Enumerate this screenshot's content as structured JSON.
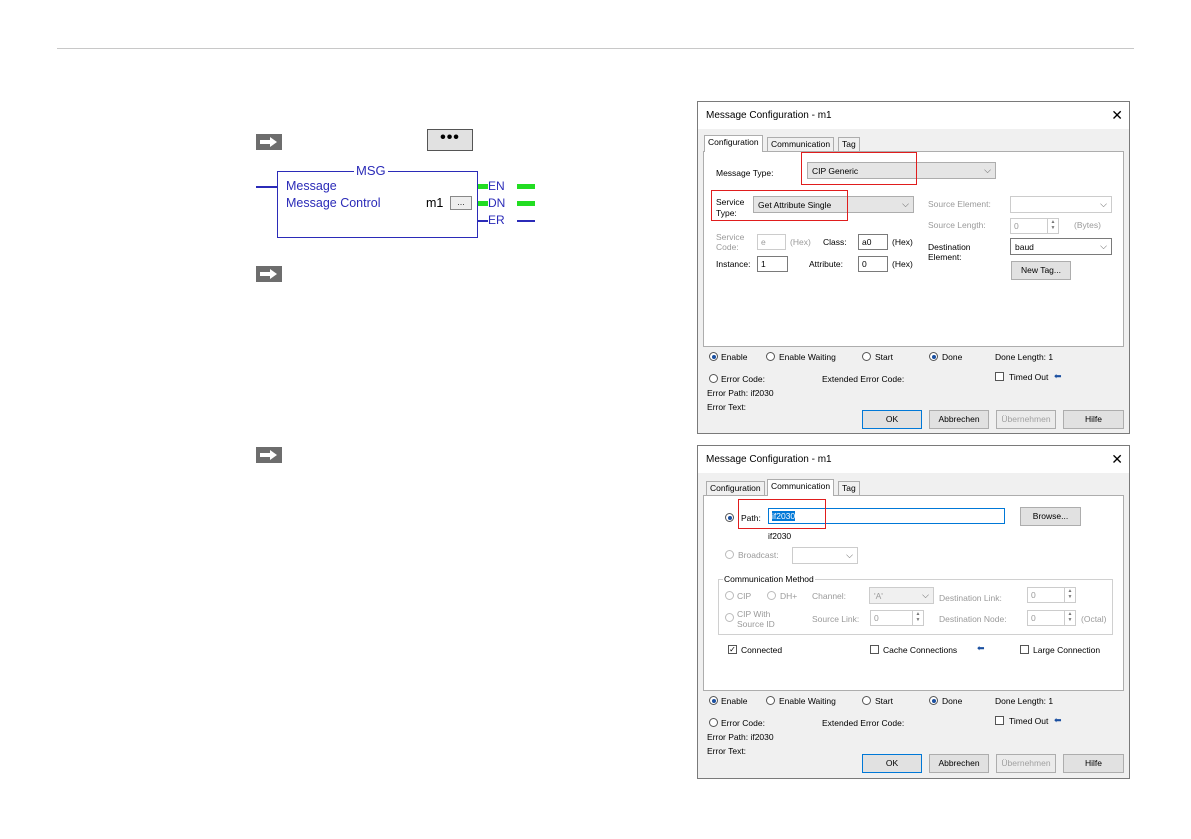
{
  "ladder": {
    "title": "MSG",
    "row1_label": "Message",
    "row2_label": "Message Control",
    "control_value": "m1",
    "mini_button": "...",
    "outputs": [
      "EN",
      "DN",
      "ER"
    ]
  },
  "dots_button": "•••",
  "dialog1": {
    "title": "Message Configuration - m1",
    "close": "✕",
    "tabs": [
      "Configuration",
      "Communication",
      "Tag"
    ],
    "message_type_label": "Message Type:",
    "message_type_value": "CIP Generic",
    "service_type_label_1": "Service",
    "service_type_label_2": "Type:",
    "service_type_value": "Get Attribute Single",
    "service_code_label_1": "Service",
    "service_code_label_2": "Code:",
    "service_code_value": "e",
    "hex_label": "(Hex)",
    "class_label": "Class:",
    "class_value": "a0",
    "instance_label": "Instance:",
    "instance_value": "1",
    "attribute_label": "Attribute:",
    "attribute_value": "0",
    "source_element_label": "Source Element:",
    "source_length_label": "Source Length:",
    "source_length_value": "0",
    "bytes_label": "(Bytes)",
    "dest_label_1": "Destination",
    "dest_label_2": "Element:",
    "dest_value": "baud",
    "new_tag": "New Tag...",
    "status": {
      "enable": "Enable",
      "enable_waiting": "Enable Waiting",
      "start": "Start",
      "done": "Done",
      "done_length": "Done Length: 1",
      "error_code": "Error Code:",
      "extended_error_code": "Extended Error Code:",
      "timed_out": "Timed Out",
      "error_path": "Error Path: if2030",
      "error_text": "Error Text:"
    },
    "buttons": [
      "OK",
      "Abbrechen",
      "Übernehmen",
      "Hilfe"
    ]
  },
  "dialog2": {
    "title": "Message Configuration - m1",
    "close": "✕",
    "tabs": [
      "Configuration",
      "Communication",
      "Tag"
    ],
    "path_label": "Path:",
    "path_value": "if2030",
    "path_resolved": "if2030",
    "browse": "Browse...",
    "broadcast_label": "Broadcast:",
    "comm_method_label": "Communication Method",
    "cip": "CIP",
    "dh": "DH+",
    "channel_label": "Channel:",
    "channel_value": "'A'",
    "dest_link_label": "Destination Link:",
    "dest_link_value": "0",
    "cip_source_1": "CIP With",
    "cip_source_2": "Source ID",
    "source_link_label": "Source Link:",
    "source_link_value": "0",
    "dest_node_label": "Destination Node:",
    "dest_node_value": "0",
    "octal_label": "(Octal)",
    "connected": "Connected",
    "cache_connections": "Cache Connections",
    "large_connection": "Large Connection",
    "status": {
      "enable": "Enable",
      "enable_waiting": "Enable Waiting",
      "start": "Start",
      "done": "Done",
      "done_length": "Done Length: 1",
      "error_code": "Error Code:",
      "extended_error_code": "Extended Error Code:",
      "timed_out": "Timed Out",
      "error_path": "Error Path: if2030",
      "error_text": "Error Text:"
    },
    "buttons": [
      "OK",
      "Abbrechen",
      "Übernehmen",
      "Hilfe"
    ]
  },
  "icons": {
    "arrow": "right-arrow-icon",
    "blue_arrow": "⬅"
  },
  "colors": {
    "ladder_blue": "#2b2bb8",
    "highlight_red": "#e01d1d",
    "energized_green": "#22dd22"
  }
}
